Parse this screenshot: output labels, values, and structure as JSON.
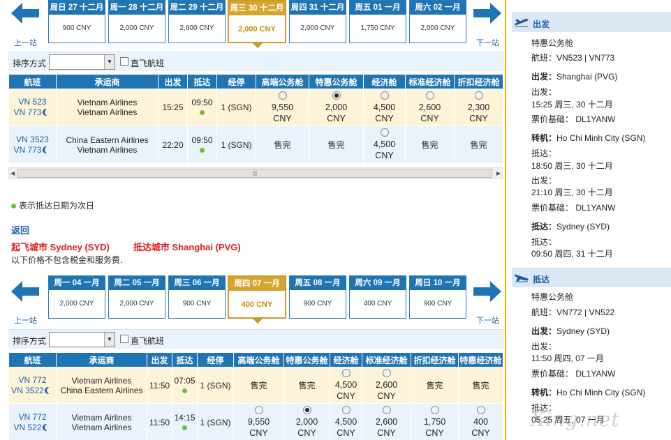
{
  "outbound": {
    "prev_label": "上一站",
    "next_label": "下一站",
    "dates": [
      {
        "label": "周日 27 十二月",
        "price": "900 CNY"
      },
      {
        "label": "周一 28 十二月",
        "price": "2,000 CNY"
      },
      {
        "label": "周二 29 十二月",
        "price": "2,600 CNY"
      },
      {
        "label": "周三 30 十二月",
        "price": "2,000 CNY",
        "selected": true
      },
      {
        "label": "周四 31 十二月",
        "price": "2,000 CNY"
      },
      {
        "label": "周五 01 一月",
        "price": "1,750 CNY"
      },
      {
        "label": "周六 02 一月",
        "price": "2,000 CNY"
      }
    ],
    "sort_label": "排序方式",
    "direct_label": "直飞航班",
    "columns": [
      "航班",
      "承运商",
      "出发",
      "抵达",
      "经停",
      "高端公务舱",
      "特惠公务舱",
      "经济舱",
      "标准经济舱",
      "折扣经济舱"
    ],
    "rows": [
      {
        "flight1": "VN 523",
        "flight2": "VN 773",
        "carrier1": "Vietnam Airlines",
        "carrier2": "Vietnam Airlines",
        "dep": "15:25",
        "arr": "09:50",
        "stops": "1 (SGN)",
        "fares": [
          {
            "price": "9,550",
            "cur": "CNY"
          },
          {
            "price": "2,000",
            "cur": "CNY",
            "checked": true
          },
          {
            "price": "4,500",
            "cur": "CNY"
          },
          {
            "price": "2,600",
            "cur": "CNY"
          },
          {
            "price": "2,300",
            "cur": "CNY"
          }
        ]
      },
      {
        "flight1": "VN 3523",
        "flight2": "VN 773",
        "carrier1": "China Eastern Airlines",
        "carrier2": "Vietnam Airlines",
        "dep": "22:20",
        "arr": "09:50",
        "stops": "1 (SGN)",
        "fares": [
          {
            "sold": "售完"
          },
          {
            "sold": "售完"
          },
          {
            "price": "4,500",
            "cur": "CNY"
          },
          {
            "sold": "售完"
          },
          {
            "sold": "售完"
          }
        ]
      }
    ],
    "next_day_note": "表示抵达日期为次日"
  },
  "return_section": {
    "title": "返回",
    "from": "起飞城市 Sydney (SYD)",
    "to": "抵达城市 Shanghai (PVG)",
    "tax_note": "以下价格不包含税金和服务费."
  },
  "inbound": {
    "prev_label": "上一站",
    "next_label": "下一站",
    "dates": [
      {
        "label": "周一 04 一月",
        "price": "2,000 CNY"
      },
      {
        "label": "周二 05 一月",
        "price": "2,000 CNY"
      },
      {
        "label": "周三 06 一月",
        "price": "900 CNY"
      },
      {
        "label": "周四 07 一月",
        "price": "400 CNY",
        "selected": true
      },
      {
        "label": "周五 08 一月",
        "price": "900 CNY"
      },
      {
        "label": "周六 09 一月",
        "price": "400 CNY"
      },
      {
        "label": "周日 10 一月",
        "price": "900 CNY"
      }
    ],
    "sort_label": "排序方式",
    "direct_label": "直飞航班",
    "columns": [
      "航班",
      "承运商",
      "出发",
      "抵达",
      "经停",
      "高端公务舱",
      "特惠公务舱",
      "经济舱",
      "标准经济舱",
      "折扣经济舱",
      "特惠经济舱"
    ],
    "rows": [
      {
        "flight1": "VN 772",
        "flight2": "VN 3522",
        "carrier1": "Vietnam Airlines",
        "carrier2": "China Eastern Airlines",
        "dep": "11:50",
        "arr": "07:05",
        "stops": "1 (SGN)",
        "fares": [
          {
            "sold": "售完"
          },
          {
            "sold": "售完"
          },
          {
            "price": "4,500",
            "cur": "CNY"
          },
          {
            "price": "2,600",
            "cur": "CNY"
          },
          {
            "sold": "售完"
          },
          {
            "sold": "售完"
          }
        ]
      },
      {
        "flight1": "VN 772",
        "flight2": "VN 522",
        "carrier1": "Vietnam Airlines",
        "carrier2": "Vietnam Airlines",
        "dep": "11:50",
        "arr": "14:15",
        "stops": "1 (SGN)",
        "fares": [
          {
            "price": "9,550",
            "cur": "CNY"
          },
          {
            "price": "2,000",
            "cur": "CNY",
            "checked": true
          },
          {
            "price": "4,500",
            "cur": "CNY"
          },
          {
            "price": "2,600",
            "cur": "CNY"
          },
          {
            "price": "1,750",
            "cur": "CNY"
          },
          {
            "price": "400",
            "cur": "CNY"
          }
        ]
      }
    ]
  },
  "summary": {
    "depart": {
      "title": "出发",
      "cabin": "特惠公务舱",
      "flight": "航班：VN523 | VN773",
      "from_lbl": "出发：",
      "from_val": "Shanghai (PVG)",
      "dep_lbl": "出发：",
      "dep_val": "15:25 周三, 30 十二月",
      "fare_basis": "票价基础：  DL1YANW",
      "transfer_lbl": "转机：",
      "transfer_val": "Ho Chi Minh City (SGN)",
      "arr1_lbl": "抵达：",
      "arr1_val": "18:50 周三, 30 十二月",
      "dep2_lbl": "出发：",
      "dep2_val": "21:10 周三, 30 十二月",
      "fare_basis2": "票价基础：  DL1YANW",
      "to_lbl": "抵达：",
      "to_val": "Sydney (SYD)",
      "arr2_lbl": "抵达：",
      "arr2_val": "09:50 周四, 31 十二月"
    },
    "arrive": {
      "title": "抵达",
      "cabin": "特惠公务舱",
      "flight": "航班：VN772 | VN522",
      "from_lbl": "出发：",
      "from_val": "Sydney (SYD)",
      "dep_lbl": "出发：",
      "dep_val": "11:50 周四, 07 一月",
      "fare_basis": "票价基础：  DL1YANW",
      "transfer_lbl": "转机：",
      "transfer_val": "Ho Chi Minh City (SGN)",
      "arr1_lbl": "抵达：",
      "arr1_val": "05:25 周五, 07 一月"
    }
  },
  "watermark": "Xing.net",
  "colors": {
    "header_blue": "#1f74b3",
    "selected_gold": "#d6a431",
    "link_blue": "#1a5ea8",
    "route_red": "#e02020"
  }
}
